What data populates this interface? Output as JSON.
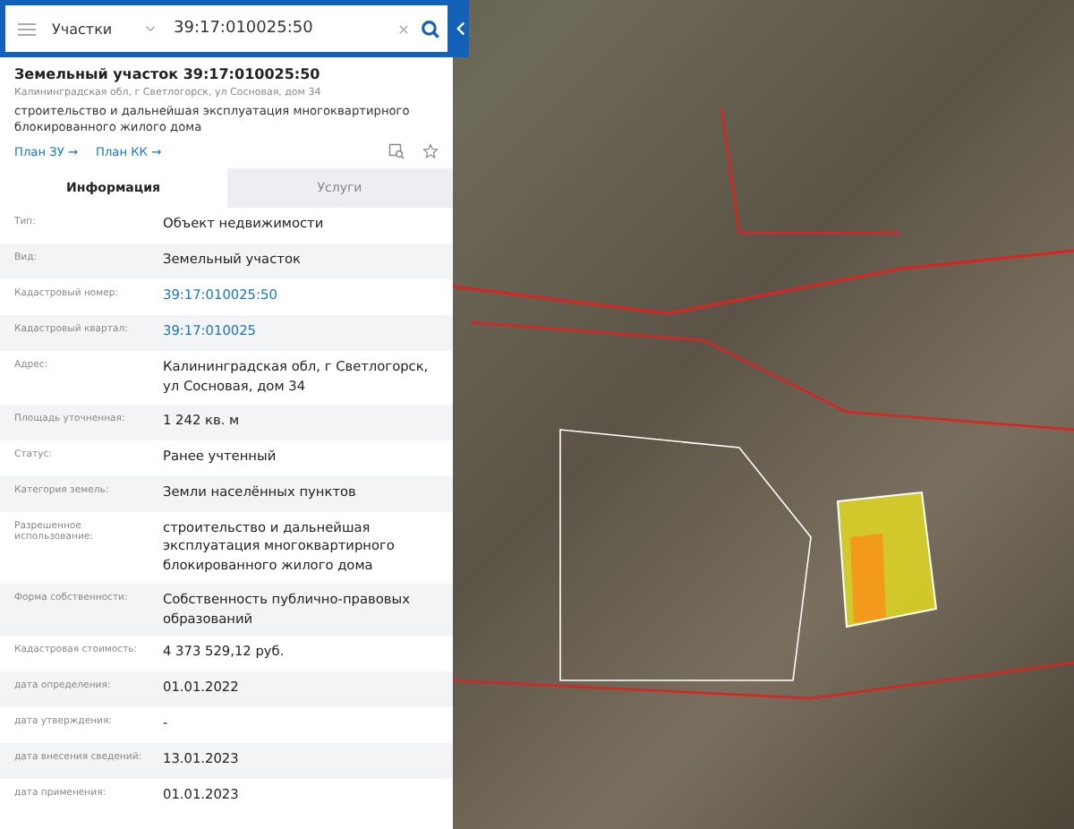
{
  "search": {
    "layer": "Участки",
    "value": "39:17:010025:50"
  },
  "object": {
    "title": "Земельный участок 39:17:010025:50",
    "address": "Калининградская обл, г Светлогорск, ул Сосновая, дом 34",
    "usage": "строительство и дальнейшая эксплуатация многоквартирного блокированного жилого дома",
    "links": [
      "План ЗУ →",
      "План КК →"
    ]
  },
  "tabs": [
    {
      "label": "Информация",
      "selected": true
    },
    {
      "label": "Услуги",
      "selected": false
    }
  ],
  "rows": [
    {
      "label": "Тип:",
      "value": "Объект недвижимости",
      "kind": "text"
    },
    {
      "label": "Вид:",
      "value": "Земельный участок",
      "kind": "text"
    },
    {
      "label": "Кадастровый номер:",
      "value": "39:17:010025:50",
      "kind": "link"
    },
    {
      "label": "Кадастровый квартал:",
      "value": "39:17:010025",
      "kind": "link"
    },
    {
      "label": "Адрес:",
      "value": "Калининградская обл, г Светлогорск, ул Сосновая, дом 34",
      "kind": "text"
    },
    {
      "label": "Площадь уточненная:",
      "value": "1 242 кв. м",
      "kind": "text"
    },
    {
      "label": "Статус:",
      "value": "Ранее учтенный",
      "kind": "text"
    },
    {
      "label": "Категория земель:",
      "value": "Земли населённых пунктов",
      "kind": "text"
    },
    {
      "label": "Разрешенное использование:",
      "value": "строительство и дальнейшая эксплуатация многоквартирного блокированного жилого дома",
      "kind": "text"
    },
    {
      "label": "Форма собственности:",
      "value": "Собственность публично-правовых образований",
      "kind": "text"
    },
    {
      "label": "Кадастровая стоимость:",
      "value": "4 373 529,12 руб.",
      "kind": "text"
    },
    {
      "label": "дата определения:",
      "value": "01.01.2022",
      "kind": "text"
    },
    {
      "label": "дата утверждения:",
      "value": "-",
      "kind": "text"
    },
    {
      "label": "дата внесения сведений:",
      "value": "13.01.2023",
      "kind": "text"
    },
    {
      "label": "дата применения:",
      "value": "01.01.2023",
      "kind": "text"
    }
  ]
}
